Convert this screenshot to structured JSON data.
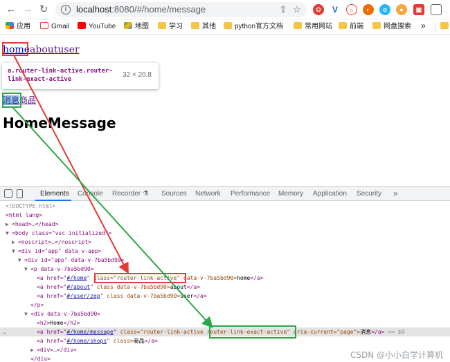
{
  "browser": {
    "url_host": "localhost",
    "url_path": ":8080/#/home/message",
    "bookmarks": [
      {
        "label": "应用",
        "icon": "apps-grid-icon"
      },
      {
        "label": "Gmail",
        "icon": "gmail-icon"
      },
      {
        "label": "YouTube",
        "icon": "youtube-icon"
      },
      {
        "label": "地图",
        "icon": "maps-icon"
      },
      {
        "label": "学习",
        "icon": "folder-icon"
      },
      {
        "label": "其他",
        "icon": "folder-icon"
      },
      {
        "label": "python官方文档",
        "icon": "folder-icon"
      },
      {
        "label": "常用网站",
        "icon": "folder-icon"
      },
      {
        "label": "前端",
        "icon": "folder-icon"
      },
      {
        "label": "网盘搜索",
        "icon": "folder-icon"
      }
    ],
    "more_bookmarks": "»"
  },
  "page": {
    "link_home": "home",
    "link_about": "about",
    "link_user": "user",
    "tooltip_selector": "a.router-link-active.router-link-exact-active",
    "tooltip_dims": "32 × 20.8",
    "sub_message": "消息",
    "sub_shops": "商品",
    "heading": "HomeMessage"
  },
  "devtools": {
    "tabs": [
      "Elements",
      "Console",
      "Recorder",
      "Sources",
      "Network",
      "Performance",
      "Memory",
      "Application",
      "Security"
    ],
    "more_tabs": "»",
    "lines": {
      "l1": "<!DOCTYPE html>",
      "l2": "<html lang>",
      "l3_tag": "<head>",
      "l3_end": "</head>",
      "l4": "<body class=\"vsc-initialized\">",
      "l5_tag": "<noscript>",
      "l5_end": "</noscript>",
      "l6": "<div id=\"app\" data-v-app>",
      "l7": "<div id=\"app\" data-v-7ba5bd90>",
      "l8": "<p data-v-7ba5bd90>",
      "l9_pre": "<a href=\"",
      "l9_href": "#/home",
      "l9_class": "class=\"router-link-active\"",
      "l9_post": " data-v-7ba5bd90>",
      "l9_text": "home",
      "l9_end": "</a>",
      "l10_href": "#/about",
      "l10_post": " class data-v-7ba5bd90>",
      "l10_text": "about",
      "l11_href": "#/user/zep",
      "l11_post": " class data-v-7ba5bd90>",
      "l11_text": "user",
      "l12": "</p>",
      "l13": "<div data-v-7ba5bd90>",
      "l14_open": "<h2>",
      "l14_text": "Home",
      "l14_close": "</h2>",
      "l15_href": "#/home/message",
      "l15_class1": " class=\"router-link-active ",
      "l15_class2": "router-link-exact-active",
      "l15_post": "\" aria-current=\"page\">",
      "l15_text": "消息",
      "l15_end": "</a>",
      "l15_dollar": "== $0",
      "l16_href": "#/home/shops",
      "l16_post": " class>",
      "l16_text": "商品",
      "l17_tag": "<div>",
      "l17_end": "</div>",
      "l18": "</div>"
    }
  },
  "watermark": "CSDN @小小白学计算机",
  "colors": {
    "highlight_red": "#e53935",
    "highlight_green": "#28a745",
    "devtools_accent": "#1a73e8"
  }
}
